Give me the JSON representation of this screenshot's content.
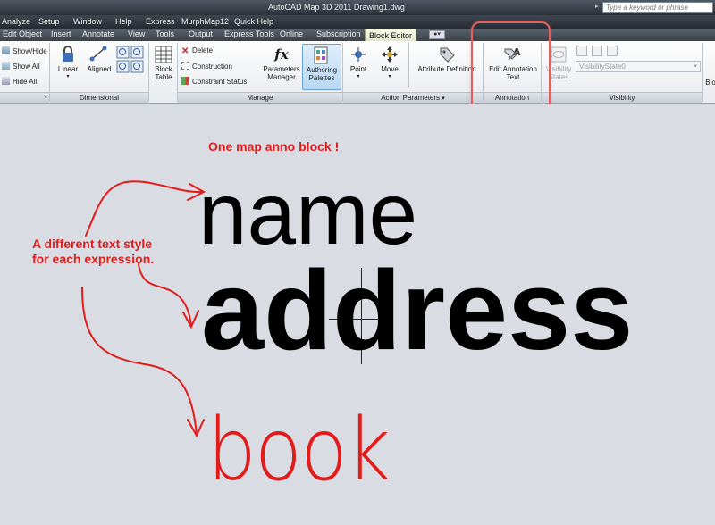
{
  "titlebar": {
    "title": "AutoCAD Map 3D 2011     Drawing1.dwg",
    "search_placeholder": "Type a keyword or phrase"
  },
  "menubar": [
    "Analyze",
    "Setup",
    "Window",
    "Help",
    "Express",
    "MurphMap12",
    "Quick Help"
  ],
  "tabs": [
    "Edit Object",
    "Insert",
    "Annotate",
    "View",
    "Tools",
    "Output",
    "Express Tools",
    "Online",
    "Subscription",
    "Block Editor"
  ],
  "ribbon": {
    "left_items": [
      "Show/Hide",
      "Show All",
      "Hide All"
    ],
    "dimensional": {
      "linear": "Linear",
      "aligned": "Aligned",
      "panel": "Dimensional"
    },
    "block_table": [
      "Block",
      "Table"
    ],
    "manage": {
      "items": [
        "Delete",
        "Construction",
        "Constraint Status"
      ],
      "params_manager": [
        "Parameters",
        "Manager"
      ],
      "authoring_palettes": [
        "Authoring",
        "Palettes"
      ],
      "panel": "Manage"
    },
    "action_parameters": {
      "point": "Point",
      "move": "Move",
      "attribute_definition": "Attribute Definition",
      "panel": "Action Parameters"
    },
    "annotation": {
      "button": [
        "Edit Annotation",
        "Text"
      ],
      "panel": "Annotation"
    },
    "visibility": {
      "states_button": [
        "Visibility",
        "States"
      ],
      "dropdown_value": "VisibilityState0",
      "panel": "Visibility",
      "cut_label": "Blo"
    }
  },
  "annotations": {
    "heading": "One map anno block !",
    "note_line1": "A different text style",
    "note_line2": "for each expression.",
    "word1": "name",
    "word2": "address",
    "word3": "book"
  },
  "colors": {
    "annotation_red": "#e21b1b",
    "highlight_box": "#e2605e",
    "active_tab": "#eef2d8",
    "canvas": "#d9dde3"
  }
}
